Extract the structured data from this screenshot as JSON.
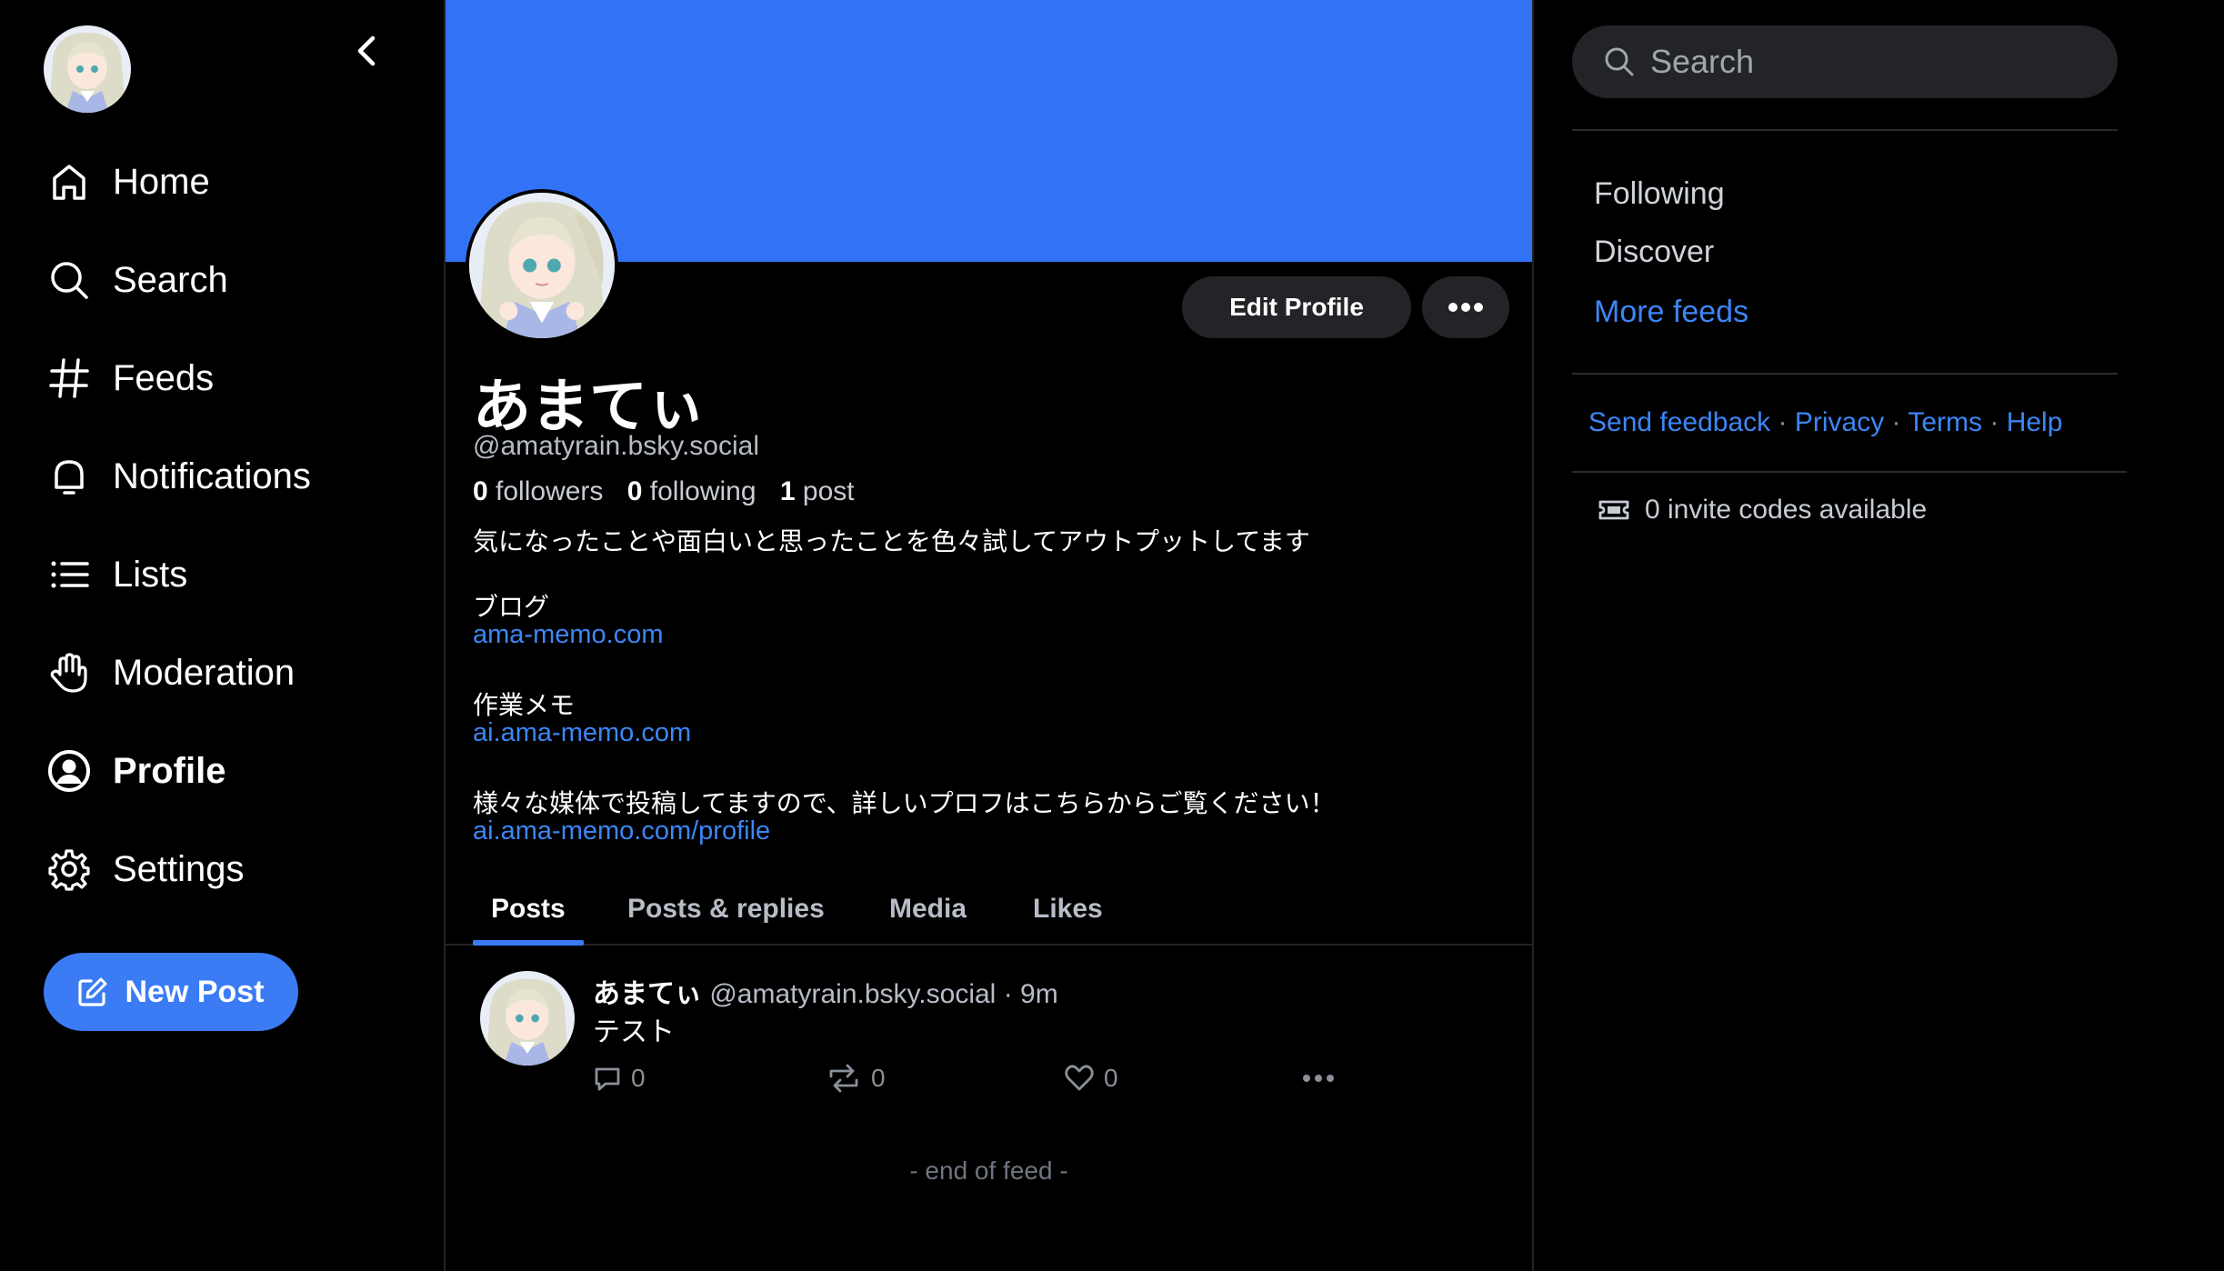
{
  "sidebar": {
    "nav": [
      {
        "label": "Home",
        "icon": "home-icon"
      },
      {
        "label": "Search",
        "icon": "search-icon"
      },
      {
        "label": "Feeds",
        "icon": "hash-icon"
      },
      {
        "label": "Notifications",
        "icon": "bell-icon"
      },
      {
        "label": "Lists",
        "icon": "list-icon"
      },
      {
        "label": "Moderation",
        "icon": "hand-icon"
      },
      {
        "label": "Profile",
        "icon": "user-circle-icon",
        "active": true
      },
      {
        "label": "Settings",
        "icon": "gear-icon"
      }
    ],
    "new_post_label": "New Post"
  },
  "profile": {
    "display_name": "あまてぃ",
    "handle": "@amatyrain.bsky.social",
    "followers_count": "0",
    "followers_label": "followers",
    "following_count": "0",
    "following_label": "following",
    "posts_count": "1",
    "posts_label": "post",
    "edit_profile_label": "Edit Profile",
    "bio_line1": "気になったことや面白いと思ったことを色々試してアウトプットしてます",
    "bio_blog_label": "ブログ",
    "bio_blog_link": "ama-memo.com",
    "bio_work_label": "作業メモ",
    "bio_work_link": "ai.ama-memo.com",
    "bio_line_last": "様々な媒体で投稿してますので、詳しいプロフはこちらからご覧ください！",
    "bio_profile_link": "ai.ama-memo.com/profile"
  },
  "tabs": [
    {
      "label": "Posts",
      "active": true
    },
    {
      "label": "Posts & replies"
    },
    {
      "label": "Media"
    },
    {
      "label": "Likes"
    }
  ],
  "post": {
    "author_name": "あまてぃ",
    "author_handle": "@amatyrain.bsky.social",
    "time": "· 9m",
    "text": "テスト",
    "reply_count": "0",
    "repost_count": "0",
    "like_count": "0"
  },
  "end_of_feed": "- end of feed -",
  "right": {
    "search_placeholder": "Search",
    "feeds": [
      "Following",
      "Discover"
    ],
    "more_feeds": "More feeds",
    "footer": [
      "Send feedback",
      "Privacy",
      "Terms",
      "Help"
    ],
    "footer_sep": "·",
    "invites": "0 invite codes available"
  },
  "colors": {
    "accent": "#3b7cf5",
    "banner": "#3273f6",
    "link": "#3d86f6",
    "background": "#000000"
  }
}
